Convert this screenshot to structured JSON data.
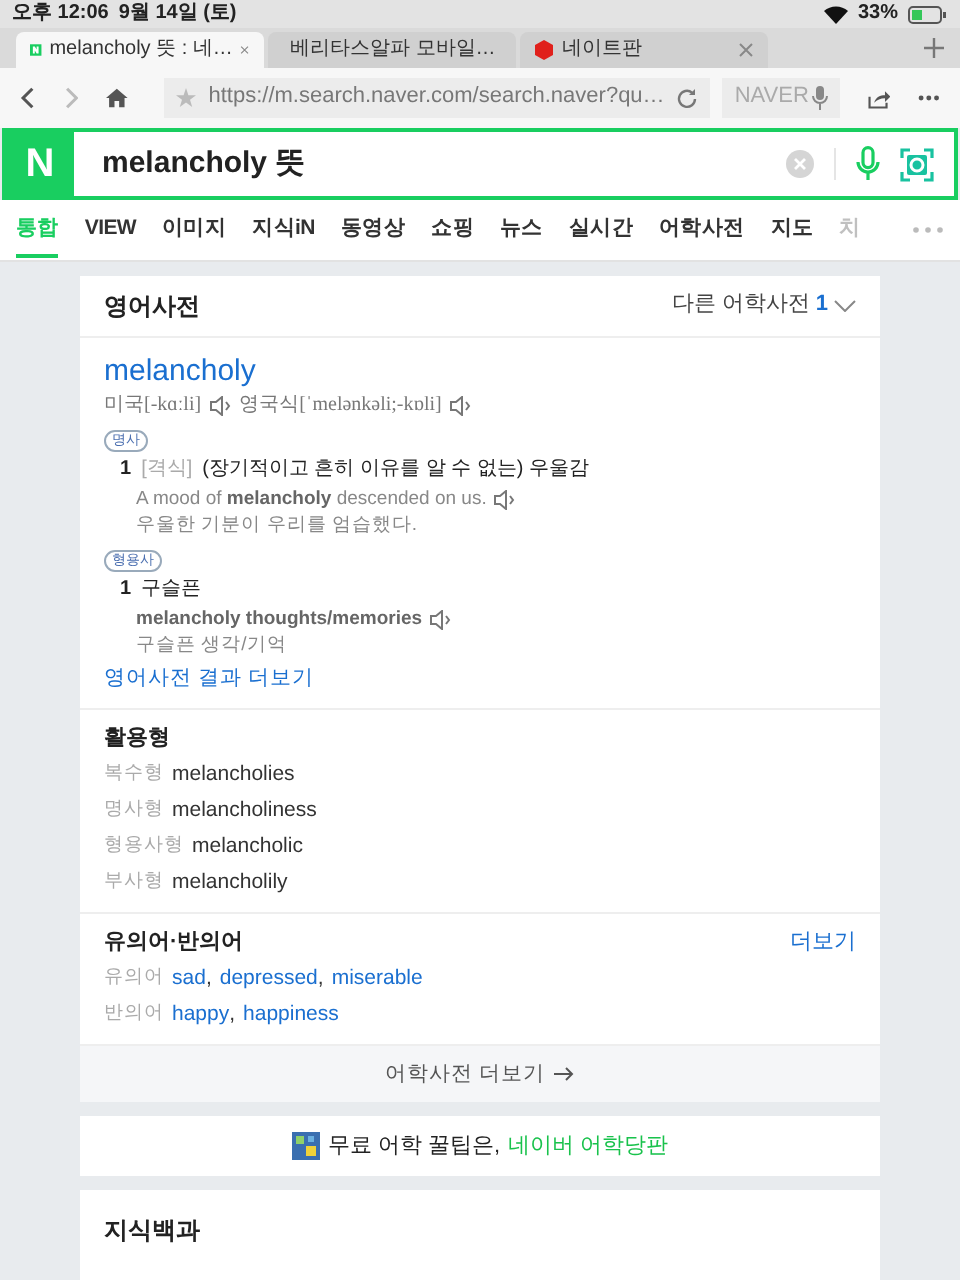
{
  "status_bar": {
    "time": "오후 12:06",
    "date": "9월 14일 (토)",
    "battery": "33%"
  },
  "browser_tabs": [
    {
      "title": "melancholy 뜻 : 네…",
      "selected": true
    },
    {
      "title": "베리타스알파 모바일…",
      "selected": false
    },
    {
      "title": "네이트판",
      "selected": false
    }
  ],
  "toolbar": {
    "url": "https://m.search.naver.com/search.naver?qu…",
    "search_engine": "NAVER"
  },
  "search": {
    "logo": "N",
    "value": "melancholy 뜻"
  },
  "categories": [
    {
      "label": "통합",
      "selected": true,
      "faded": false
    },
    {
      "label": "VIEW",
      "selected": false,
      "faded": false
    },
    {
      "label": "이미지",
      "selected": false,
      "faded": false
    },
    {
      "label": "지식iN",
      "selected": false,
      "faded": false
    },
    {
      "label": "동영상",
      "selected": false,
      "faded": false
    },
    {
      "label": "쇼핑",
      "selected": false,
      "faded": false
    },
    {
      "label": "뉴스",
      "selected": false,
      "faded": false
    },
    {
      "label": "실시간",
      "selected": false,
      "faded": false
    },
    {
      "label": "어학사전",
      "selected": false,
      "faded": false
    },
    {
      "label": "지도",
      "selected": false,
      "faded": false
    },
    {
      "label": "치",
      "selected": false,
      "faded": true
    }
  ],
  "dictionary": {
    "title": "영어사전",
    "other_label": "다른 어학사전",
    "other_count": "1",
    "word": "melancholy",
    "pronunciations": [
      {
        "label": "미국[-kɑːli]"
      },
      {
        "label": "영국식[ˈmelənkəli;-kɒli]"
      }
    ],
    "senses": [
      {
        "pos": "명사",
        "number": "1",
        "tag": "[격식]",
        "meaning": "(장기적이고 흔히 이유를 알 수 없는) 우울감",
        "example": "A mood of **melancholy** descended on us.",
        "translation": "우울한 기분이 우리를 엄습했다."
      },
      {
        "pos": "형용사",
        "number": "1",
        "meaning": "구슬픈",
        "example": "**melancholy thoughts/memories**",
        "translation": "구슬픈 생각/기억"
      }
    ],
    "more_link": "영어사전 결과 더보기",
    "forms_title": "활용형",
    "forms": [
      {
        "label": "복수형",
        "value": "melancholies"
      },
      {
        "label": "명사형",
        "value": "melancholiness"
      },
      {
        "label": "형용사형",
        "value": "melancholic"
      },
      {
        "label": "부사형",
        "value": "melancholily"
      }
    ],
    "relations_title": "유의어·반의어",
    "relations_more": "더보기",
    "relations": [
      {
        "label": "유의어",
        "separator": ",",
        "words": [
          "sad",
          "depressed",
          "miserable"
        ]
      },
      {
        "label": "반의어",
        "separator": ",",
        "words": [
          "happy",
          "happiness"
        ]
      }
    ],
    "footer_link": "어학사전 더보기"
  },
  "promo": {
    "text": "무료 어학 꿀팁은,",
    "link": "네이버 어학당판"
  },
  "next_section": {
    "title": "지식백과"
  }
}
